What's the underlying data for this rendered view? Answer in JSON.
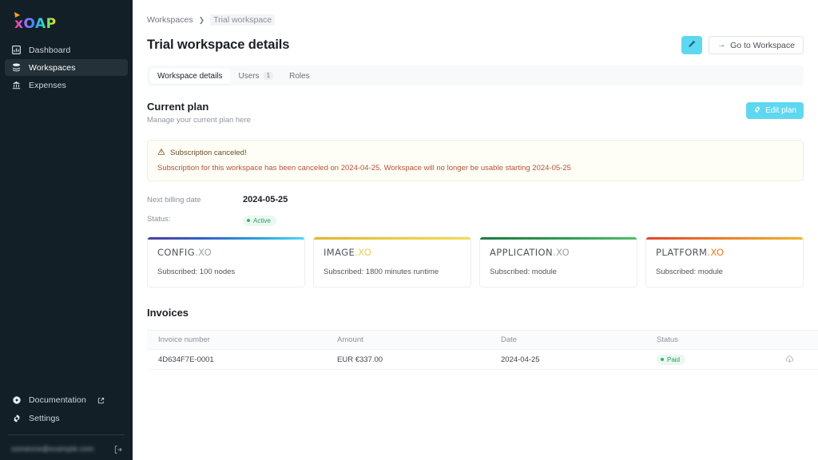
{
  "brand": {
    "logo_text": "xOAP",
    "accent_cyan": "#5ed8f0"
  },
  "sidebar": {
    "items": [
      {
        "label": "Dashboard",
        "icon": "bar-chart-icon",
        "active": false
      },
      {
        "label": "Workspaces",
        "icon": "layers-icon",
        "active": true
      },
      {
        "label": "Expenses",
        "icon": "bank-icon",
        "active": false
      }
    ],
    "bottom_items": [
      {
        "label": "Documentation",
        "icon": "info-icon",
        "external": true
      },
      {
        "label": "Settings",
        "icon": "gear-icon",
        "external": false
      }
    ],
    "user_email": "someone@example.com",
    "logout_icon": "logout-icon"
  },
  "breadcrumb": {
    "parent": "Workspaces",
    "separator": "❯",
    "current": "Trial workspace"
  },
  "header": {
    "title": "Trial workspace details",
    "edit_icon": "pencil-icon",
    "goto_label": "Go to Workspace",
    "goto_arrow": "→"
  },
  "tabs": [
    {
      "label": "Workspace details",
      "badge": "",
      "active": true
    },
    {
      "label": "Users",
      "badge": "1",
      "active": false
    },
    {
      "label": "Roles",
      "badge": "",
      "active": false
    }
  ],
  "plan_section": {
    "title": "Current plan",
    "subtitle": "Manage your current plan here",
    "edit_plan_label": "Edit plan",
    "edit_plan_icon": "gear-icon"
  },
  "alert": {
    "icon": "warning-triangle-icon",
    "heading": "Subscription canceled!",
    "body": "Subscription for this workspace has been canceled on 2024-04-25. Workspace will no longer be usable starting 2024-05-25",
    "bg": "#fefdf6",
    "text_color": "#b4543c"
  },
  "details": [
    {
      "key": "Next billing date",
      "value": "2024-05-25",
      "type": "text"
    },
    {
      "key": "Status:",
      "value": "Active",
      "type": "pill",
      "pill_color": "#2fb36f"
    }
  ],
  "plan_cards": [
    {
      "name_main": "CONFIG",
      "name_suffix": ".XO",
      "suffix_color": "#9aa1a9",
      "subscribed": "Subscribed: 100 nodes",
      "accent": "#2b9fe0"
    },
    {
      "name_main": "IMAGE",
      "name_suffix": ".XO",
      "suffix_color": "#e8cf4e",
      "subscribed": "Subscribed: 1800 minutes runtime",
      "accent": "#eccb3a"
    },
    {
      "name_main": "APPLICATION",
      "name_suffix": ".XO",
      "suffix_color": "#9aa1a9",
      "subscribed": "Subscribed: module",
      "accent": "#2f9e52"
    },
    {
      "name_main": "PLATFORM",
      "name_suffix": ".XO",
      "suffix_color": "#ec7a22",
      "subscribed": "Subscribed: module",
      "accent": "#ec7a22"
    }
  ],
  "invoices": {
    "title": "Invoices",
    "columns": [
      "Invoice number",
      "Amount",
      "Date",
      "Status",
      ""
    ],
    "rows": [
      {
        "number": "4D634F7E-0001",
        "amount": "EUR €337.00",
        "date": "2024-04-25",
        "status": "Paid",
        "download_icon": "download-icon"
      }
    ]
  }
}
